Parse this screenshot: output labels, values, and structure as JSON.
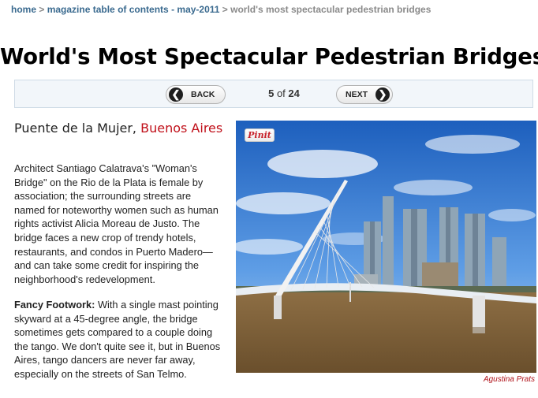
{
  "breadcrumb": {
    "home": "home",
    "sep1": " > ",
    "magazine": "magazine table of contents - may-2011",
    "sep2": " > ",
    "current": "world's most spectacular pedestrian bridges"
  },
  "title": "World's Most Spectacular Pedestrian Bridges",
  "pager": {
    "back_label": "BACK",
    "next_label": "NEXT",
    "current": "5",
    "of": " of ",
    "total": "24"
  },
  "article": {
    "heading": "Puente de la Mujer, ",
    "location": "Buenos Aires",
    "paragraph1": "Architect Santiago Calatrava's \"Woman's Bridge\" on the Rio de la Plata is female by association; the surrounding streets are named for noteworthy women such as human rights activist Alicia Moreau de Justo. The bridge faces a new crop of trendy hotels, restaurants, and condos in Puerto Madero—and can take some credit for inspiring the neighborhood's redevelopment.",
    "paragraph2_lead": "Fancy Footwork:",
    "paragraph2": " With a single mast pointing skyward at a 45-degree angle, the bridge sometimes gets compared to a couple doing the tango. We don't quite see it, but in Buenos Aires, tango dancers are never far away, especially on the streets of San Telmo."
  },
  "photo": {
    "pin_label": "Pinit",
    "credit": "Agustina Prats"
  }
}
